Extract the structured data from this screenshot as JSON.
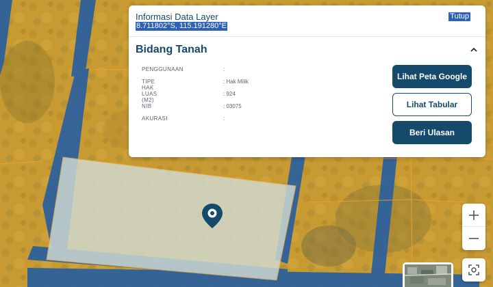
{
  "panel": {
    "layer_title": "Informasi Data Layer",
    "coordinates": "8.711802°S, 115.191280°E",
    "close_label": "Tutup",
    "section_title": "Bidang Tanah",
    "attributes": [
      {
        "key": "PENGGUNAAN",
        "value": ""
      },
      {
        "key": "TIPE HAK",
        "value": "Hak Milik"
      },
      {
        "key": "LUAS (M2)",
        "value": "924"
      },
      {
        "key": "NIB",
        "value": "03075"
      },
      {
        "key": "AKURASI",
        "value": ""
      }
    ],
    "buttons": {
      "peta_google": "Lihat Peta Google",
      "tabular": "Lihat Tabular",
      "ulasan": "Beri Ulasan"
    }
  },
  "icons": {
    "collapse": "chevron-up-icon",
    "zoom_in": "plus-icon",
    "zoom_out": "minus-icon",
    "locate": "locate-icon",
    "marker": "map-pin-icon"
  },
  "colors": {
    "primary": "#154a6d",
    "selection_highlight": "#2d62b8",
    "parcel_border": "#2a5f9e",
    "selected_parcel": "#cfd8cf"
  }
}
